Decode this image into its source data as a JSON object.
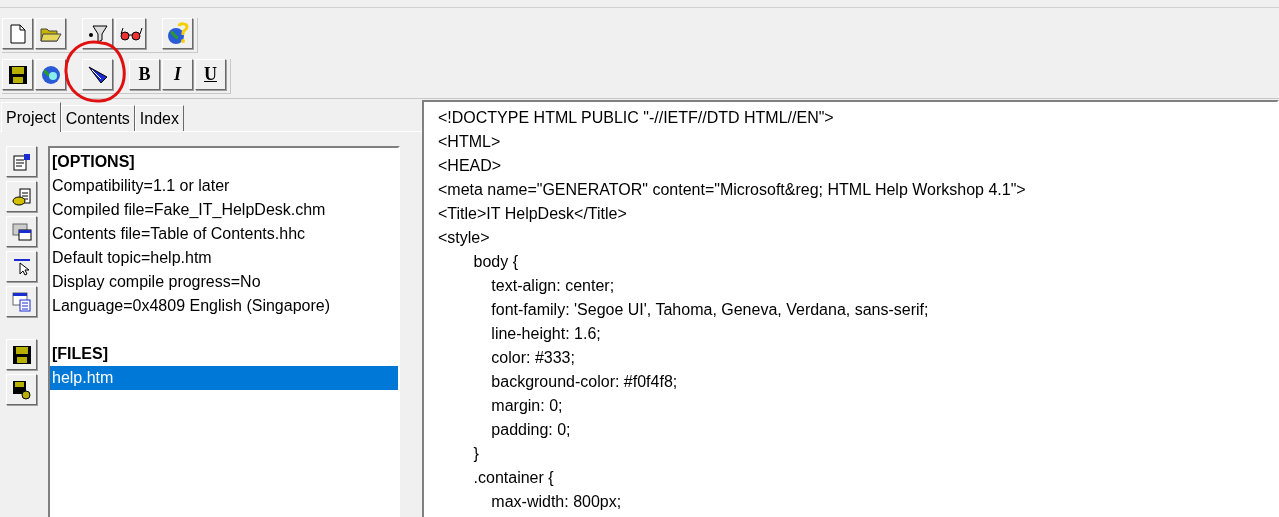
{
  "format_buttons": [
    "B",
    "I",
    "U"
  ],
  "annotation": {
    "circled": true
  },
  "tabs": [
    {
      "label": "Project",
      "selected": true
    },
    {
      "label": "Contents",
      "selected": false
    },
    {
      "label": "Index",
      "selected": false
    }
  ],
  "project_list": [
    {
      "kind": "heading",
      "text": "[OPTIONS]",
      "selected": false
    },
    {
      "kind": "item",
      "text": "Compatibility=1.1 or later",
      "selected": false
    },
    {
      "kind": "item",
      "text": "Compiled file=Fake_IT_HelpDesk.chm",
      "selected": false
    },
    {
      "kind": "item",
      "text": "Contents file=Table of Contents.hhc",
      "selected": false
    },
    {
      "kind": "item",
      "text": "Default topic=help.htm",
      "selected": false
    },
    {
      "kind": "item",
      "text": "Display compile progress=No",
      "selected": false
    },
    {
      "kind": "item",
      "text": "Language=0x4809 English (Singapore)",
      "selected": false
    },
    {
      "kind": "blank"
    },
    {
      "kind": "heading",
      "text": "[FILES]",
      "selected": false
    },
    {
      "kind": "item",
      "text": "help.htm",
      "selected": true
    }
  ],
  "editor_lines": [
    "<!DOCTYPE HTML PUBLIC \"-//IETF//DTD HTML//EN\">",
    "<HTML>",
    "<HEAD>",
    "<meta name=\"GENERATOR\" content=\"Microsoft&reg; HTML Help Workshop 4.1\">",
    "<Title>IT HelpDesk</Title>",
    "<style>",
    "        body {",
    "            text-align: center;",
    "            font-family: 'Segoe UI', Tahoma, Geneva, Verdana, sans-serif;",
    "            line-height: 1.6;",
    "            color: #333;",
    "            background-color: #f0f4f8;",
    "            margin: 0;",
    "            padding: 0;",
    "        }",
    "        .container {",
    "            max-width: 800px;"
  ]
}
